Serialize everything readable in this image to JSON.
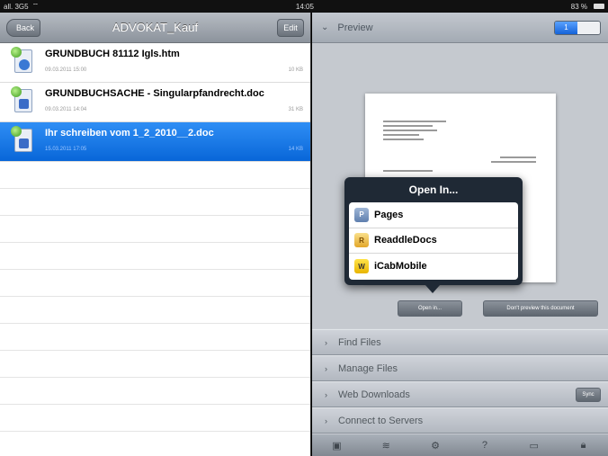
{
  "status_bar": {
    "carrier": "all. 3G5",
    "wifi_icon": "wifi-icon",
    "time": "14:05",
    "battery": "83 %"
  },
  "left_nav": {
    "back_label": "Back",
    "title": "ADVOKAT_Kauf",
    "edit_label": "Edit"
  },
  "files": [
    {
      "name": "GRUNDBUCH 81112 Igls.htm",
      "date": "09.03.2011 15:00",
      "size": "10 KB",
      "icon": "html-file-icon",
      "selected": false
    },
    {
      "name": "GRUNDBUCHSACHE - Singularpfandrecht.doc",
      "date": "09.03.2011 14:04",
      "size": "31 KB",
      "icon": "doc-file-icon",
      "selected": false
    },
    {
      "name": "Ihr schreiben vom 1_2_2010__2.doc",
      "date": "15.03.2011 17:05",
      "size": "14 KB",
      "icon": "doc-file-icon",
      "selected": true
    }
  ],
  "preview": {
    "header": "Preview",
    "segment_label": "1"
  },
  "popover": {
    "title": "Open In...",
    "items": [
      {
        "label": "Pages",
        "icon": "pages-app-icon",
        "glyph": "P"
      },
      {
        "label": "ReaddleDocs",
        "icon": "readdledocs-app-icon",
        "glyph": "R"
      },
      {
        "label": "iCabMobile",
        "icon": "icabmobile-app-icon",
        "glyph": "W"
      }
    ]
  },
  "preview_buttons": {
    "open_in": "Open in...",
    "dont_preview": "Don't preview this document"
  },
  "sections": [
    {
      "label": "Find Files"
    },
    {
      "label": "Manage Files"
    },
    {
      "label": "Web Downloads",
      "button": "Sync"
    },
    {
      "label": "Connect to Servers"
    }
  ],
  "toolbar_icons": [
    "picture-icon",
    "wifi-icon",
    "gear-icon",
    "help-icon",
    "screen-icon",
    "lock-icon"
  ],
  "colors": {
    "selection": "#0866d8",
    "popover": "#1f2935"
  }
}
